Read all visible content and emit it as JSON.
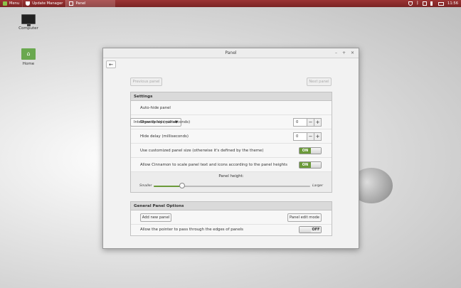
{
  "taskbar": {
    "menu_label": "Menu",
    "windows": [
      {
        "label": "Update Manager"
      },
      {
        "label": "Panel"
      }
    ],
    "clock": "11:56"
  },
  "desktop": {
    "icons": [
      {
        "label": "Computer",
        "icon": "computer-icon"
      },
      {
        "label": "Home",
        "icon": "home-folder-icon"
      }
    ]
  },
  "window": {
    "title": "Panel",
    "back_button": "←",
    "previous_panel": "Previous panel",
    "next_panel": "Next panel"
  },
  "settings": {
    "title": "Settings",
    "auto_hide_label": "Auto-hide panel",
    "auto_hide_value": "Intelligently hide panel",
    "show_delay_label": "Show delay (milliseconds)",
    "show_delay_value": "0",
    "hide_delay_label": "Hide delay (milliseconds)",
    "hide_delay_value": "0",
    "custom_size_label": "Use customized panel size (otherwise it's defined by the theme)",
    "custom_size_state": "ON",
    "scale_label": "Allow Cinnamon to scale panel text and icons according to the panel heights",
    "scale_state": "ON",
    "panel_height_label": "Panel height:",
    "smaller_label": "Smaller",
    "larger_label": "Larger",
    "panel_height_level": 0.18
  },
  "general": {
    "title": "General Panel Options",
    "add_panel": "Add new panel",
    "edit_mode": "Panel edit mode",
    "pass_pointer_label": "Allow the pointer to pass through the edges of panels",
    "pass_pointer_state": "OFF"
  },
  "colors": {
    "taskbar": "#8a2c2c",
    "accent_green": "#6b9a3a"
  }
}
